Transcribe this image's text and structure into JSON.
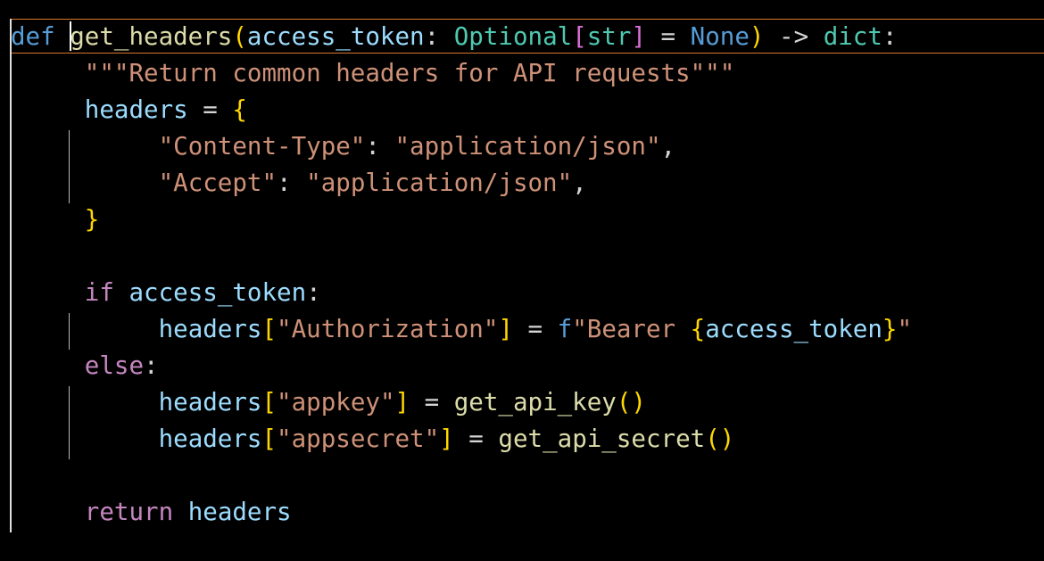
{
  "code": {
    "line1": {
      "kw_def": "def",
      "fn_name": "get_headers",
      "paren_open": "(",
      "param": "access_token",
      "colon": ": ",
      "type_optional": "Optional",
      "bracket_open": "[",
      "type_str": "str",
      "bracket_close": "]",
      "eq": " = ",
      "none": "None",
      "paren_close": ")",
      "arrow": " -> ",
      "type_dict": "dict",
      "end_colon": ":"
    },
    "line2": {
      "docstring": "\"\"\"Return common headers for API requests\"\"\""
    },
    "line3": {
      "var": "headers",
      "eq": " = ",
      "brace_open": "{"
    },
    "line4": {
      "key": "\"Content-Type\"",
      "colon": ": ",
      "value": "\"application/json\"",
      "comma": ","
    },
    "line5": {
      "key": "\"Accept\"",
      "colon": ": ",
      "value": "\"application/json\"",
      "comma": ","
    },
    "line6": {
      "brace_close": "}"
    },
    "line7": {
      "kw_if": "if",
      "var": "access_token",
      "colon": ":"
    },
    "line8": {
      "var": "headers",
      "bracket_open": "[",
      "key": "\"Authorization\"",
      "bracket_close": "]",
      "eq": " = ",
      "fprefix": "f",
      "str_start": "\"Bearer ",
      "interp_open": "{",
      "interp_var": "access_token",
      "interp_close": "}",
      "str_end": "\""
    },
    "line9": {
      "kw_else": "else",
      "colon": ":"
    },
    "line10": {
      "var": "headers",
      "bracket_open": "[",
      "key": "\"appkey\"",
      "bracket_close": "]",
      "eq": " = ",
      "call": "get_api_key",
      "parens": "()"
    },
    "line11": {
      "var": "headers",
      "bracket_open": "[",
      "key": "\"appsecret\"",
      "bracket_close": "]",
      "eq": " = ",
      "call": "get_api_secret",
      "parens": "()"
    },
    "line12": {
      "kw_return": "return",
      "var": "headers"
    }
  },
  "colors": {
    "background": "#000000",
    "keyword": "#569cd6",
    "control": "#c586c0",
    "function": "#dcdcaa",
    "variable": "#9cdcfe",
    "type": "#4ec9b0",
    "string": "#ce9178",
    "bracket_level1": "#ffd700",
    "bracket_level2": "#da70d6",
    "bracket_level3": "#179fff",
    "current_line_border": "#d9772f"
  }
}
